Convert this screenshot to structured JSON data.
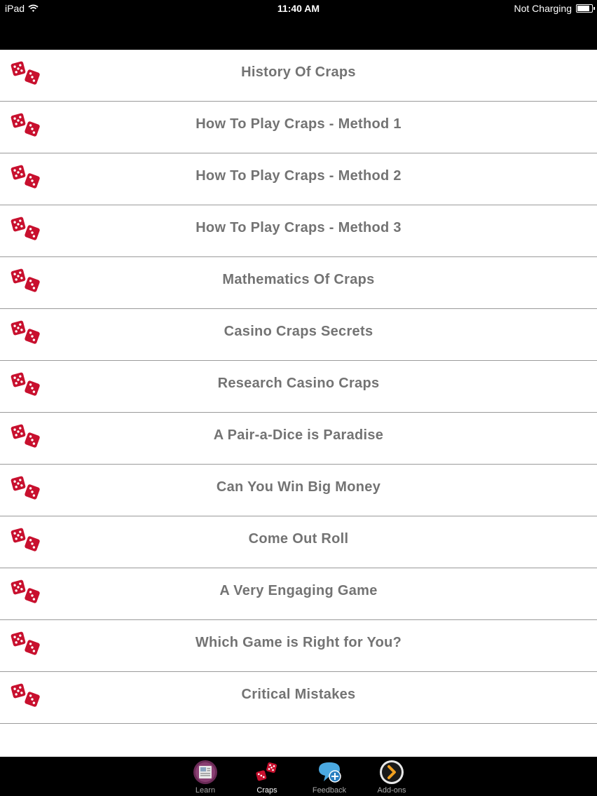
{
  "status_bar": {
    "device": "iPad",
    "time": "11:40 AM",
    "charging": "Not Charging",
    "battery_level": 0.85
  },
  "list": {
    "icon": "dice-icon",
    "items": [
      {
        "label": "History Of Craps"
      },
      {
        "label": "How To Play Craps - Method 1"
      },
      {
        "label": "How To Play Craps - Method 2"
      },
      {
        "label": "How To Play Craps - Method 3"
      },
      {
        "label": "Mathematics Of Craps"
      },
      {
        "label": "Casino Craps Secrets"
      },
      {
        "label": "Research Casino Craps"
      },
      {
        "label": "A Pair-a-Dice is Paradise"
      },
      {
        "label": "Can You Win Big Money"
      },
      {
        "label": "Come Out Roll"
      },
      {
        "label": "A Very Engaging Game"
      },
      {
        "label": "Which Game is Right for You?"
      },
      {
        "label": "Critical Mistakes"
      }
    ]
  },
  "tab_bar": {
    "tabs": [
      {
        "label": "Learn",
        "icon": "book-icon"
      },
      {
        "label": "Craps",
        "icon": "dice-icon",
        "active": true
      },
      {
        "label": "Feedback",
        "icon": "speech-bubble-plus-icon"
      },
      {
        "label": "Add-ons",
        "icon": "chevron-right-icon"
      }
    ]
  },
  "colors": {
    "dice_red": "#c8102e",
    "label_gray": "#737373",
    "bar_black": "#000000",
    "divider": "#9a9a9a"
  }
}
